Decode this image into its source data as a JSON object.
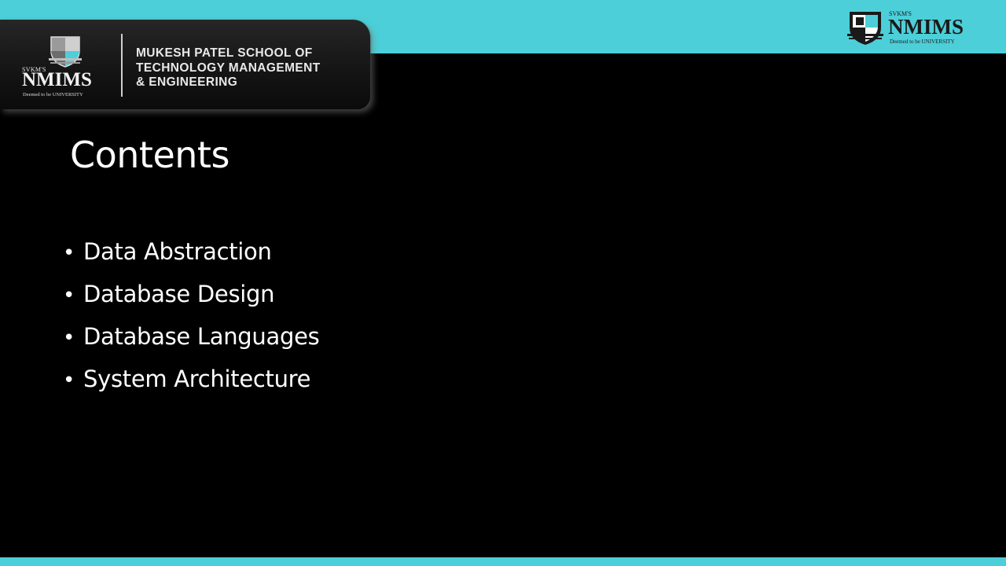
{
  "slide": {
    "title": "Contents",
    "bullets": [
      "Data Abstraction",
      "Database Design",
      "Database Languages",
      "System Architecture"
    ]
  },
  "header": {
    "logo": {
      "prefix": "SVKM'S",
      "name": "NMIMS",
      "tagline": "Deemed to be UNIVERSITY"
    },
    "school_lines": [
      "MUKESH PATEL SCHOOL OF",
      "TECHNOLOGY MANAGEMENT",
      "& ENGINEERING"
    ]
  },
  "corner_logo": {
    "prefix": "SVKM'S",
    "name": "NMIMS",
    "tagline": "Deemed to be UNIVERSITY"
  },
  "colors": {
    "accent": "#4ccfd8",
    "background": "#000000",
    "text": "#ffffff"
  },
  "icons": {
    "header_emblem": "nmims-shield-emblem-icon",
    "corner_emblem": "nmims-shield-emblem-icon"
  }
}
